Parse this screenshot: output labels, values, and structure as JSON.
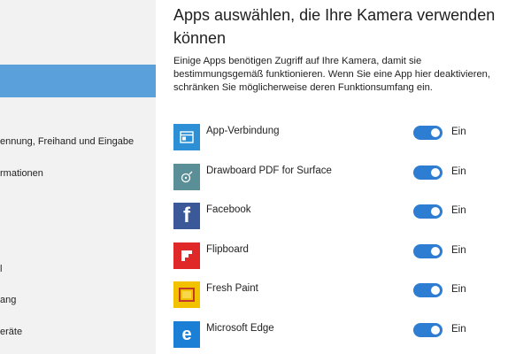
{
  "colors": {
    "sidebar_bg": "#f2f2f2",
    "sidebar_selected": "#5aa0db",
    "toggle_on": "#2d7dd2"
  },
  "sidebar": {
    "items": [
      {
        "label": "ennung, Freihand und Eingabe"
      },
      {
        "label": "rmationen"
      },
      {
        "label": "l"
      },
      {
        "label": "ang"
      },
      {
        "label": "eräte"
      }
    ]
  },
  "main": {
    "heading": "Apps auswählen, die Ihre Kamera verwenden können",
    "description": "Einige Apps benötigen Zugriff auf Ihre Kamera, damit sie bestimmungsgemäß funktionieren. Wenn Sie eine App hier deaktivieren, schränken Sie möglicherweise deren Funktionsumfang ein.",
    "apps": [
      {
        "name": "App-Verbindung",
        "icon": "app-connector-icon",
        "icon_color": "#2d8fd5",
        "state": "Ein",
        "on": true
      },
      {
        "name": "Drawboard PDF for Surface",
        "icon": "drawboard-icon",
        "icon_color": "#5b8f98",
        "state": "Ein",
        "on": true
      },
      {
        "name": "Facebook",
        "icon": "facebook-icon",
        "icon_color": "#3b5998",
        "state": "Ein",
        "on": true
      },
      {
        "name": "Flipboard",
        "icon": "flipboard-icon",
        "icon_color": "#e12828",
        "state": "Ein",
        "on": true
      },
      {
        "name": "Fresh Paint",
        "icon": "fresh-paint-icon",
        "icon_color": "#f2c200",
        "state": "Ein",
        "on": true
      },
      {
        "name": "Microsoft Edge",
        "icon": "edge-icon",
        "icon_color": "#1b7fd6",
        "state": "Ein",
        "on": true
      }
    ]
  }
}
